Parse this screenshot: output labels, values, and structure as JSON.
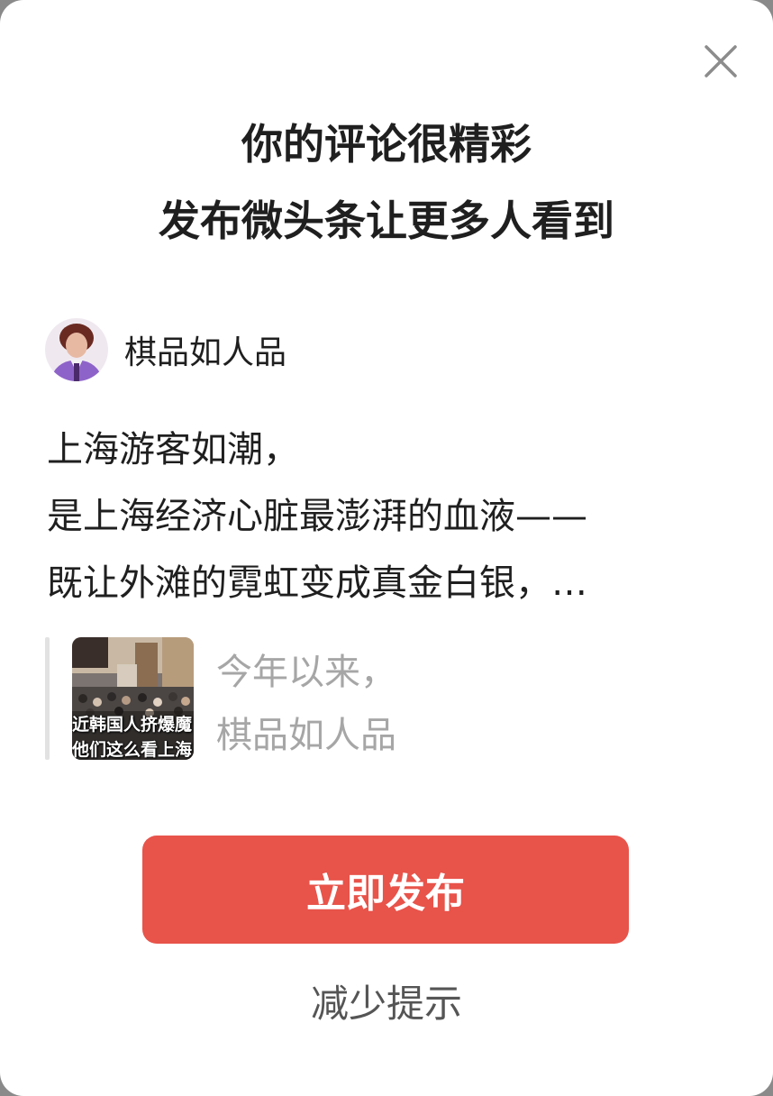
{
  "dialog": {
    "title_line1": "你的评论很精彩",
    "title_line2": "发布微头条让更多人看到",
    "close_icon": "close-icon"
  },
  "author": {
    "name": "棋品如人品",
    "avatar_icon": "avatar"
  },
  "post": {
    "lines": [
      "上海游客如潮，",
      "是上海经济心脏最澎湃的血液——",
      "既让外滩的霓虹变成真金白银，…"
    ]
  },
  "quote": {
    "thumbnail_caption_line1": "近韩国人挤爆魔",
    "thumbnail_caption_line2": "他们这么看上海",
    "text_line1": "今年以来，",
    "text_line2": "棋品如人品"
  },
  "actions": {
    "publish_label": "立即发布",
    "reduce_label": "减少提示"
  },
  "colors": {
    "accent": "#e8534a",
    "title_text": "#1f1f1f",
    "muted_text": "#a6a6a6",
    "secondary_text": "#555555"
  }
}
